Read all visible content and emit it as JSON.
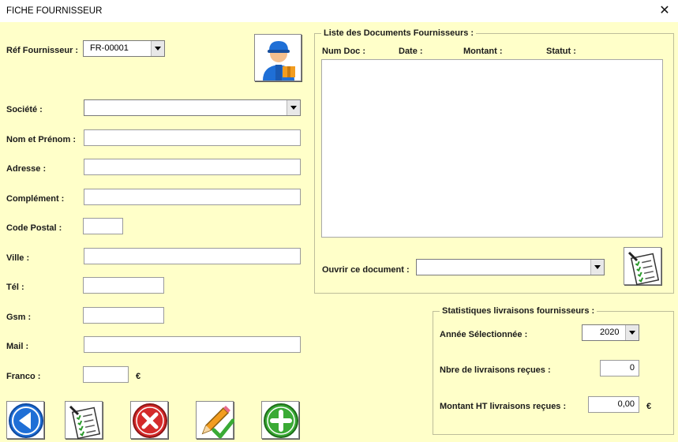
{
  "window": {
    "title": "FICHE FOURNISSEUR",
    "close_glyph": "✕"
  },
  "fields": {
    "ref_label": "Réf Fournisseur :",
    "ref_value": "FR-00001",
    "societe_label": "Société :",
    "societe_value": "",
    "nom_label": "Nom et Prénom :",
    "nom_value": "",
    "adresse_label": "Adresse :",
    "adresse_value": "",
    "complement_label": "Complément :",
    "complement_value": "",
    "cp_label": "Code Postal :",
    "cp_value": "",
    "ville_label": "Ville :",
    "ville_value": "",
    "tel_label": "Tél :",
    "tel_value": "",
    "gsm_label": "Gsm :",
    "gsm_value": "",
    "mail_label": "Mail :",
    "mail_value": "",
    "franco_label": "Franco :",
    "franco_value": "",
    "franco_unit": "€"
  },
  "documents": {
    "frame_title": "Liste des Documents Fournisseurs :",
    "columns": [
      "Num Doc :",
      "Date :",
      "Montant :",
      "Statut :"
    ],
    "rows": [],
    "open_label": "Ouvrir ce document :",
    "open_value": ""
  },
  "stats": {
    "frame_title": "Statistiques livraisons fournisseurs :",
    "year_label": "Année Sélectionnée :",
    "year_value": "2020",
    "count_label": "Nbre de livraisons reçues :",
    "count_value": "0",
    "amount_label": "Montant HT livraisons reçues :",
    "amount_value": "0,00",
    "amount_unit": "€"
  },
  "icons": {
    "supplier_avatar": "delivery-worker-icon",
    "open_doc": "document-checklist-icon",
    "back": "back-arrow-icon",
    "list": "document-checklist-icon",
    "delete": "delete-x-icon",
    "edit": "pencil-check-icon",
    "add": "add-plus-icon"
  },
  "colors": {
    "form_background": "#ffffc9",
    "back_blue": "#1f6fd6",
    "delete_red": "#d42a2a",
    "add_green": "#3aaa35",
    "pencil_orange": "#f29c1f"
  }
}
